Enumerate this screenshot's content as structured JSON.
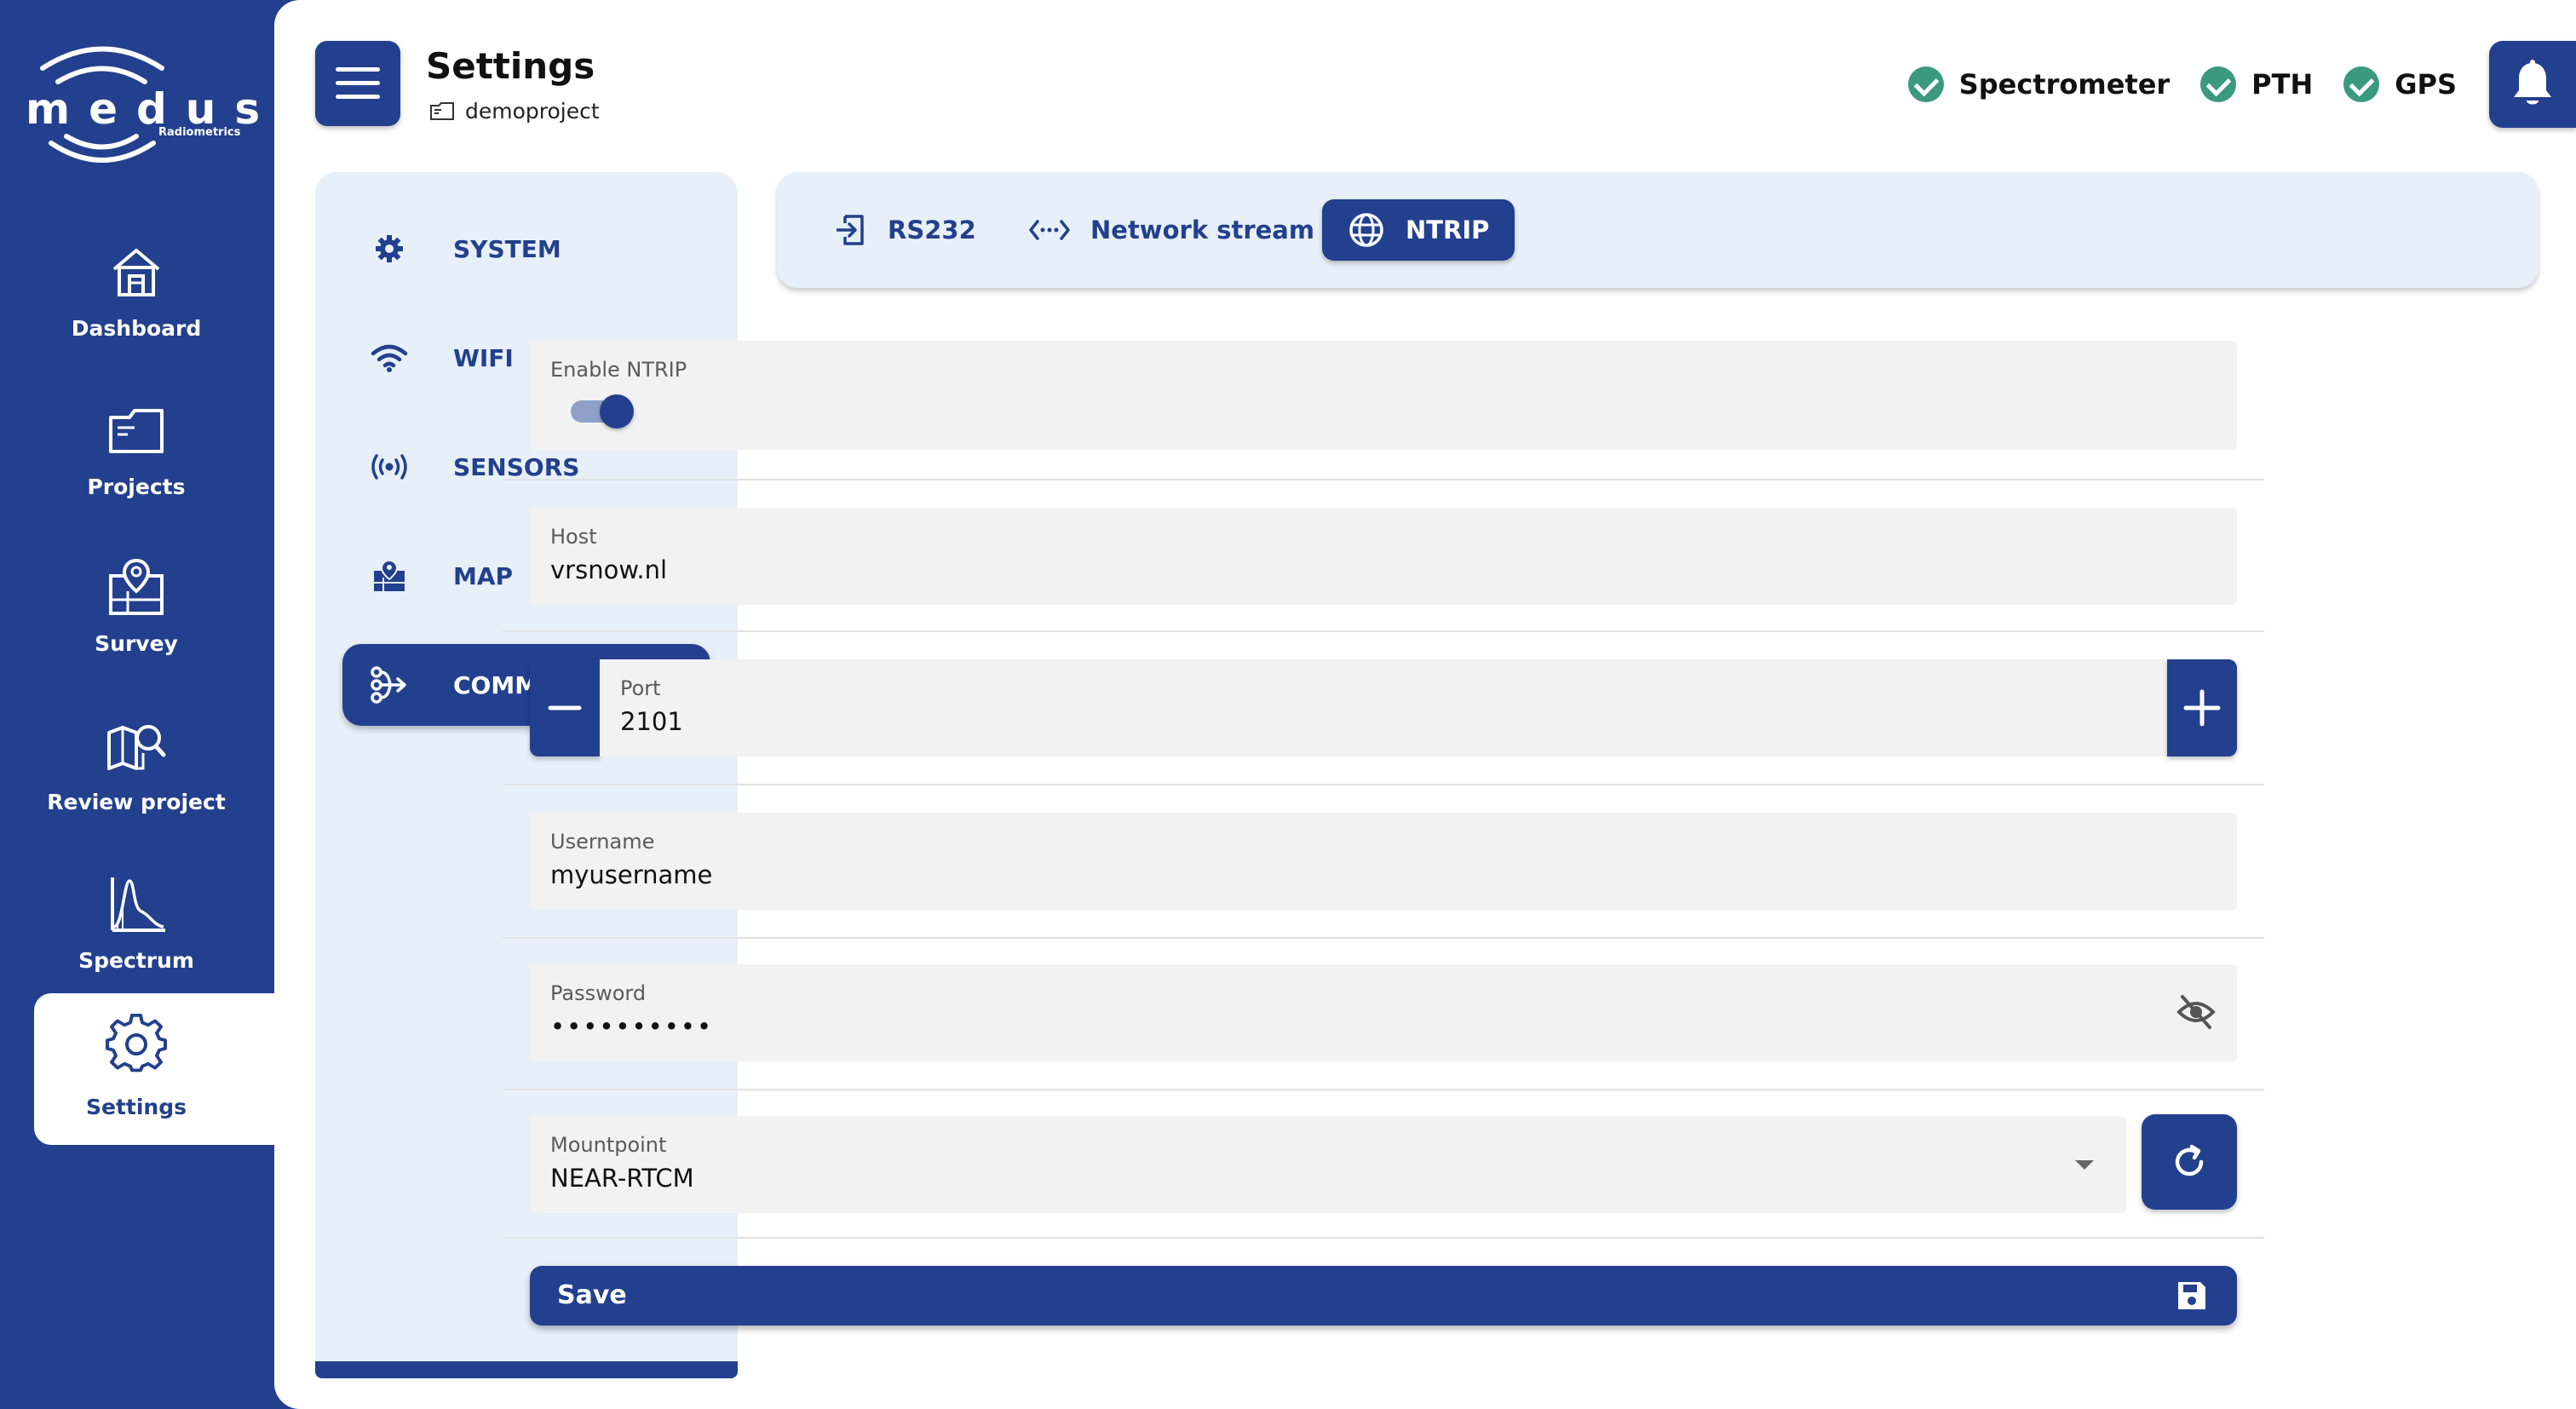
{
  "app": {
    "logo_text": "medusa",
    "logo_subtext": "Radiometrics"
  },
  "nav": {
    "items": [
      {
        "label": "Dashboard",
        "icon": "home-icon"
      },
      {
        "label": "Projects",
        "icon": "folder-icon"
      },
      {
        "label": "Survey",
        "icon": "survey-map-icon"
      },
      {
        "label": "Review project",
        "icon": "map-search-icon"
      },
      {
        "label": "Spectrum",
        "icon": "spectrum-icon"
      },
      {
        "label": "Settings",
        "icon": "gear-icon",
        "active": true
      }
    ]
  },
  "header": {
    "title": "Settings",
    "project": "demoproject",
    "statuses": [
      {
        "label": "Spectrometer",
        "state": "ok"
      },
      {
        "label": "PTH",
        "state": "ok"
      },
      {
        "label": "GPS",
        "state": "ok"
      }
    ]
  },
  "categories": [
    {
      "label": "SYSTEM",
      "icon": "gear-icon"
    },
    {
      "label": "WIFI",
      "icon": "wifi-icon"
    },
    {
      "label": "SENSORS",
      "icon": "sensor-icon"
    },
    {
      "label": "MAP",
      "icon": "map-icon"
    },
    {
      "label": "COMMUNICATION",
      "icon": "communication-icon",
      "active": true
    }
  ],
  "tabs": [
    {
      "label": "RS232",
      "icon": "input-icon"
    },
    {
      "label": "Network stream",
      "icon": "code-icon"
    },
    {
      "label": "NTRIP",
      "icon": "globe-icon",
      "active": true
    }
  ],
  "form": {
    "enable_label": "Enable NTRIP",
    "enabled": true,
    "host_label": "Host",
    "host_value": "vrsnow.nl",
    "port_label": "Port",
    "port_value": "2101",
    "username_label": "Username",
    "username_value": "myusername",
    "password_label": "Password",
    "password_value": "••••••••••",
    "mountpoint_label": "Mountpoint",
    "mountpoint_value": "NEAR-RTCM",
    "save_label": "Save"
  },
  "colors": {
    "primary": "#23408e",
    "panel": "#e7f0f8",
    "ok": "#3a9a7e",
    "field": "#f2f2f2"
  }
}
